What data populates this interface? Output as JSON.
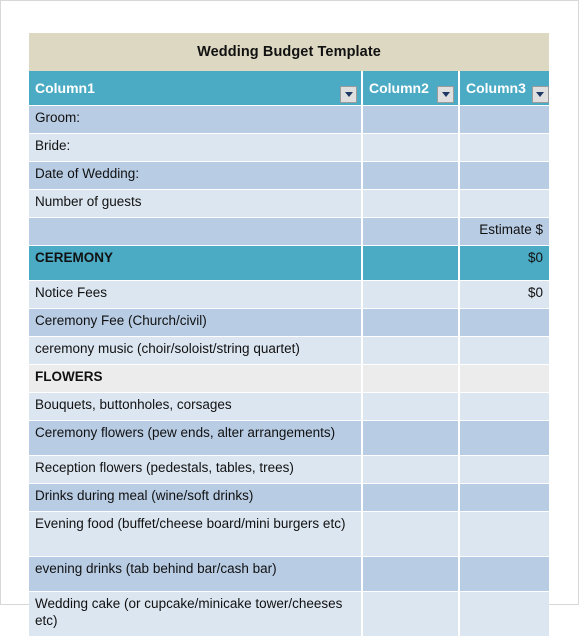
{
  "document": {
    "title": "Wedding Budget Template"
  },
  "colors": {
    "title_banner": "#ddd8c2",
    "header_teal": "#4babc5",
    "row_dark": "#b8cce4",
    "row_light": "#dce6f1",
    "row_gray": "#ececec",
    "text": "#111111",
    "header_text": "#ffffff"
  },
  "table": {
    "headers": [
      {
        "label": "Column1",
        "filter_icon": "chevron-down-icon"
      },
      {
        "label": "Column2",
        "filter_icon": "chevron-down-icon"
      },
      {
        "label": "Column3",
        "filter_icon": "chevron-down-icon"
      }
    ],
    "rows": [
      {
        "c1": "Groom:",
        "c2": "",
        "c3": ""
      },
      {
        "c1": "Bride:",
        "c2": "",
        "c3": ""
      },
      {
        "c1": "Date of Wedding:",
        "c2": "",
        "c3": ""
      },
      {
        "c1": "Number of guests",
        "c2": "",
        "c3": ""
      },
      {
        "c1": "",
        "c2": "",
        "c3": "Estimate $"
      },
      {
        "c1": "CEREMONY",
        "c2": "",
        "c3": "$0"
      },
      {
        "c1": "Notice Fees",
        "c2": "",
        "c3": "$0"
      },
      {
        "c1": "Ceremony Fee (Church/civil)",
        "c2": "",
        "c3": ""
      },
      {
        "c1": "ceremony music (choir/soloist/string quartet)",
        "c2": "",
        "c3": ""
      },
      {
        "c1": "FLOWERS",
        "c2": "",
        "c3": ""
      },
      {
        "c1": "Bouquets, buttonholes, corsages",
        "c2": "",
        "c3": ""
      },
      {
        "c1": "Ceremony flowers (pew ends, alter arrangements)",
        "c2": "",
        "c3": ""
      },
      {
        "c1": "Reception flowers (pedestals, tables, trees)",
        "c2": "",
        "c3": ""
      },
      {
        "c1": "Drinks during meal (wine/soft drinks)",
        "c2": "",
        "c3": ""
      },
      {
        "c1": "Evening food (buffet/cheese board/mini burgers etc)",
        "c2": "",
        "c3": ""
      },
      {
        "c1": "evening drinks (tab behind bar/cash bar)",
        "c2": "",
        "c3": ""
      },
      {
        "c1": "Wedding cake (or cupcake/minicake tower/cheeses etc)",
        "c2": "",
        "c3": ""
      }
    ]
  }
}
